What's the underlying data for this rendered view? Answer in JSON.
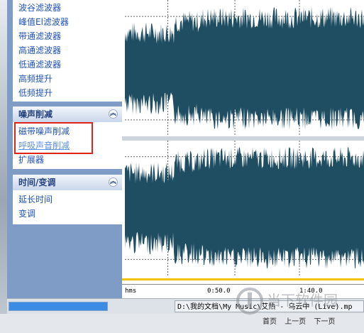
{
  "sidebar": {
    "filters_items": [
      {
        "label": "波谷滤波器"
      },
      {
        "label": "峰值El滤波器"
      },
      {
        "label": "带通滤波器"
      },
      {
        "label": "高通滤波器"
      },
      {
        "label": "低通滤波器"
      },
      {
        "label": "高频提升"
      },
      {
        "label": "低频提升"
      }
    ],
    "noise_panel": {
      "title": "噪声削减",
      "items": [
        {
          "label": "磁带噪声削减"
        },
        {
          "label": "呼吸声音削减"
        },
        {
          "label": "扩展器"
        }
      ]
    },
    "time_panel": {
      "title": "时间/变调",
      "items": [
        {
          "label": "延长时间"
        },
        {
          "label": "变调"
        }
      ]
    },
    "collapse_icon": "chevron-up-double"
  },
  "ruler": {
    "unit": "hms",
    "mark1": "0:50.0",
    "mark2": "1:40.0"
  },
  "statusbar": {
    "progress_fraction": 0.28,
    "file_path": "D:\\我的文档\\My Music\\艾热 - 乌云中 (Live).mp"
  },
  "nav": {
    "first": "首页",
    "prev": "上一页",
    "next": "下一页"
  },
  "watermark": {
    "text": "当下软件园"
  },
  "colors": {
    "waveform": "#1f4e63",
    "highlight": "#e2231a",
    "link": "#1f52b8"
  }
}
